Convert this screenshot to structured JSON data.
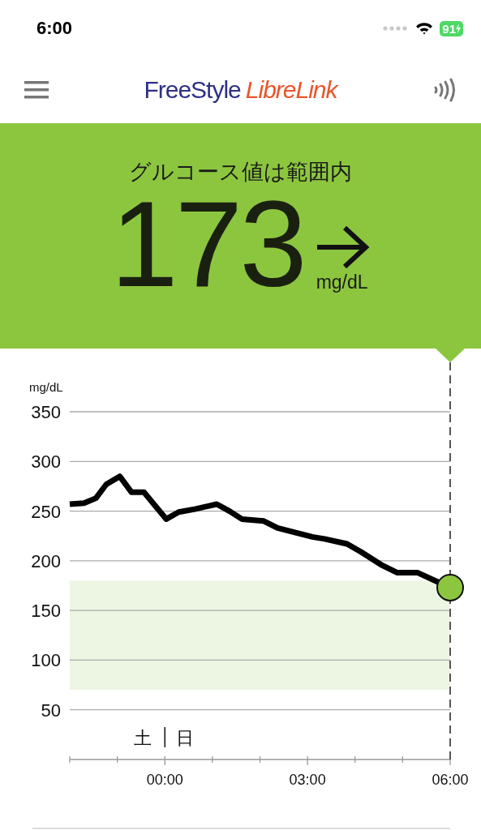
{
  "status_bar": {
    "time": "6:00",
    "battery": "91"
  },
  "header": {
    "logo": [
      "FreeStyle",
      "LibreLink"
    ]
  },
  "banner": {
    "status": "グルコース値は範囲内",
    "value": "173",
    "trend": {
      "kind": "right"
    },
    "unit": "mg/dL"
  },
  "chart": {
    "day_labels": [
      "土",
      "日"
    ],
    "chart_data": {
      "type": "line",
      "ylabel": "mg/dL",
      "x": [
        -2,
        -1.7,
        -1.45,
        -1.23,
        -0.95,
        -0.7,
        -0.44,
        0.03,
        0.29,
        0.63,
        1.09,
        1.36,
        1.62,
        2.08,
        2.37,
        3.1,
        3.36,
        3.83,
        4.12,
        4.55,
        4.89,
        5.32,
        6
      ],
      "series": [
        {
          "color": "#000000",
          "values": [
            257,
            258,
            263,
            277,
            285,
            269,
            269,
            242,
            249,
            252,
            257,
            250,
            242,
            240,
            233,
            224,
            222,
            217,
            209,
            196,
            188,
            188,
            173
          ]
        }
      ],
      "xlim": [
        -2,
        6
      ],
      "ylim": [
        0,
        350
      ],
      "xticks": [
        {
          "value": 0,
          "label": "00:00"
        },
        {
          "value": 3,
          "label": "03:00"
        },
        {
          "value": 6,
          "label": "06:00"
        }
      ],
      "yticks": [
        50,
        100,
        150,
        200,
        250,
        300,
        350
      ],
      "grid": true,
      "bands": [
        {
          "axis": "y",
          "from": 70,
          "to": 180
        }
      ]
    }
  }
}
